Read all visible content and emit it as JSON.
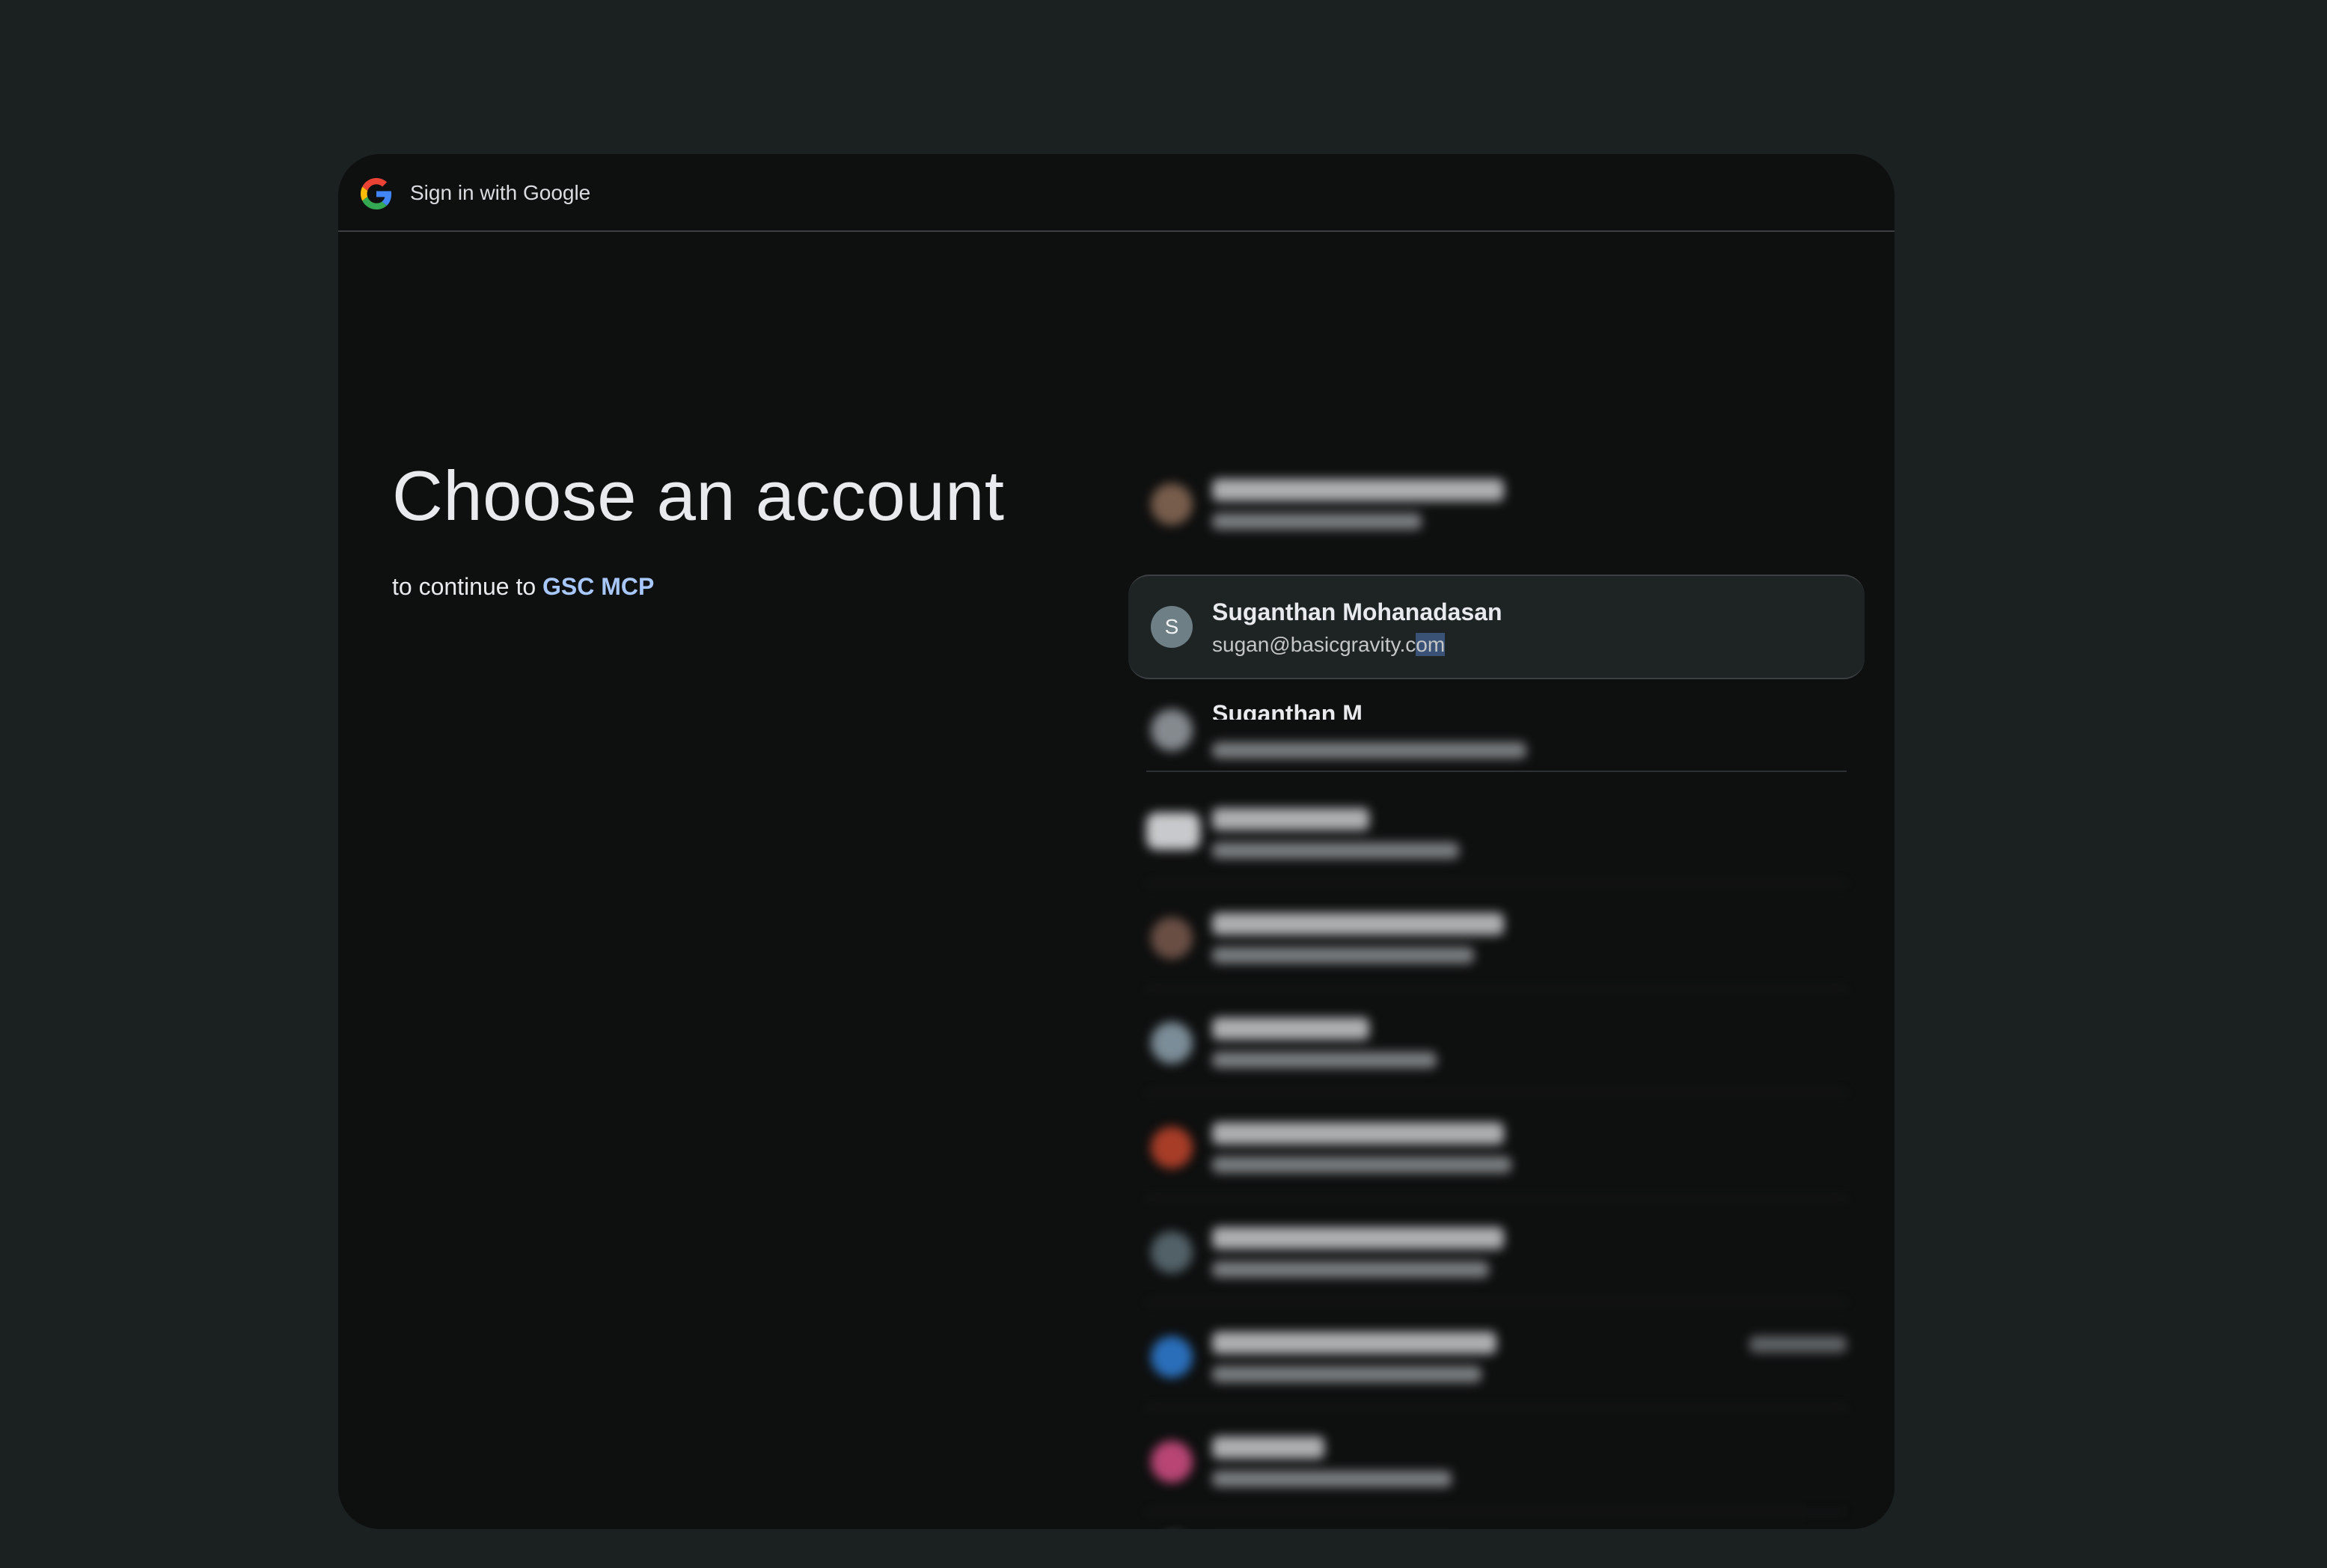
{
  "header": {
    "title": "Sign in with Google",
    "logo_icon": "google-g-icon"
  },
  "main": {
    "headline": "Choose an account",
    "continue_prefix": "to continue to",
    "app_name": "GSC MCP"
  },
  "accounts": {
    "selected": {
      "avatar_letter": "S",
      "name": "Suganthan Mohanadasan",
      "email_prefix": "sugan@basicgravity.c",
      "email_highlight": "om"
    },
    "partial_visible_name": "Suganthan M"
  },
  "colors": {
    "background": "#1b2021",
    "dialog": "#0e0f0f",
    "link": "#a8c7fa",
    "avatar_selected": "#6f7f86"
  }
}
